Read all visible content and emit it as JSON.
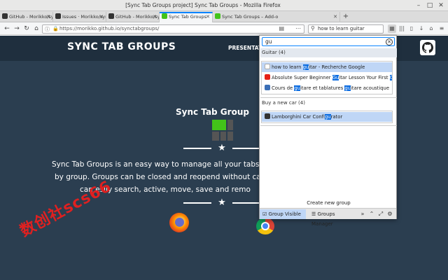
{
  "window": {
    "title": "[Sync Tab Groups project] Sync Tab Groups - Mozilla Firefox",
    "minimize_icon": "minimize-icon",
    "maximize_icon": "maximize-icon",
    "close_icon": "close-icon"
  },
  "tabs": [
    {
      "label": "GitHub - Morikko/sync-ta",
      "favicon": "github-icon",
      "active": false
    },
    {
      "label": "Issues · Morikko/sync-ta",
      "favicon": "github-icon",
      "active": false
    },
    {
      "label": "GitHub - Morikko/synctab",
      "favicon": "github-icon",
      "active": false
    },
    {
      "label": "Sync Tab Groups",
      "favicon": "sync-tab-groups-icon",
      "active": true
    },
    {
      "label": "Sync Tab Groups – Add-o",
      "favicon": "sync-tab-groups-icon",
      "active": false
    }
  ],
  "navbar": {
    "url": "https://morikko.github.io/synctabgroups/",
    "search_text": "how to learn guitar"
  },
  "site": {
    "logo": "SYNC TAB GROUPS",
    "nav": "PRESENTAT",
    "hero_title": "Sync Tab Group",
    "desc_lines": [
      "Sync Tab Groups is an easy way to manage all your tabs. Yo",
      "by group. Groups can be closed and reopend without carin",
      "can esily search, active, move, save and remo"
    ],
    "watermark": "数创社scs66"
  },
  "popup": {
    "search_value": "gu",
    "groups": [
      {
        "name": "Guitar (4)",
        "selected": true,
        "tabs": [
          {
            "parts": [
              "how to learn ",
              "gu",
              "itar - Recherche Google"
            ],
            "favicon": "google-icon",
            "selected": true
          },
          {
            "parts": [
              "Absolute Super Beginner ",
              "Gu",
              "itar Lesson Your First ",
              "Gu",
              "itar"
            ],
            "favicon": "youtube-icon",
            "selected": false
          },
          {
            "parts": [
              "Cours de ",
              "gu",
              "itare et tablatures ",
              "gu",
              "itare acoustique"
            ],
            "favicon": "guitar-site-icon",
            "selected": false
          }
        ]
      },
      {
        "name": "Buy a new car (4)",
        "selected": false,
        "tabs": [
          {
            "parts": [
              "Lamborghini Car Confi",
              "gu",
              "rator"
            ],
            "favicon": "lamborghini-icon",
            "selected": true
          }
        ]
      }
    ],
    "create_group": "Create new group",
    "footer": {
      "group_visible": "Group Visible",
      "groups_manager": "Groups Manager"
    }
  },
  "colors": {
    "page_bg": "#2b3e50",
    "header_bg": "#1f2f3e",
    "accent": "#0a84ff",
    "selection": "#bfd6f6",
    "highlight": "#0a6be0",
    "watermark": "#e02020"
  }
}
